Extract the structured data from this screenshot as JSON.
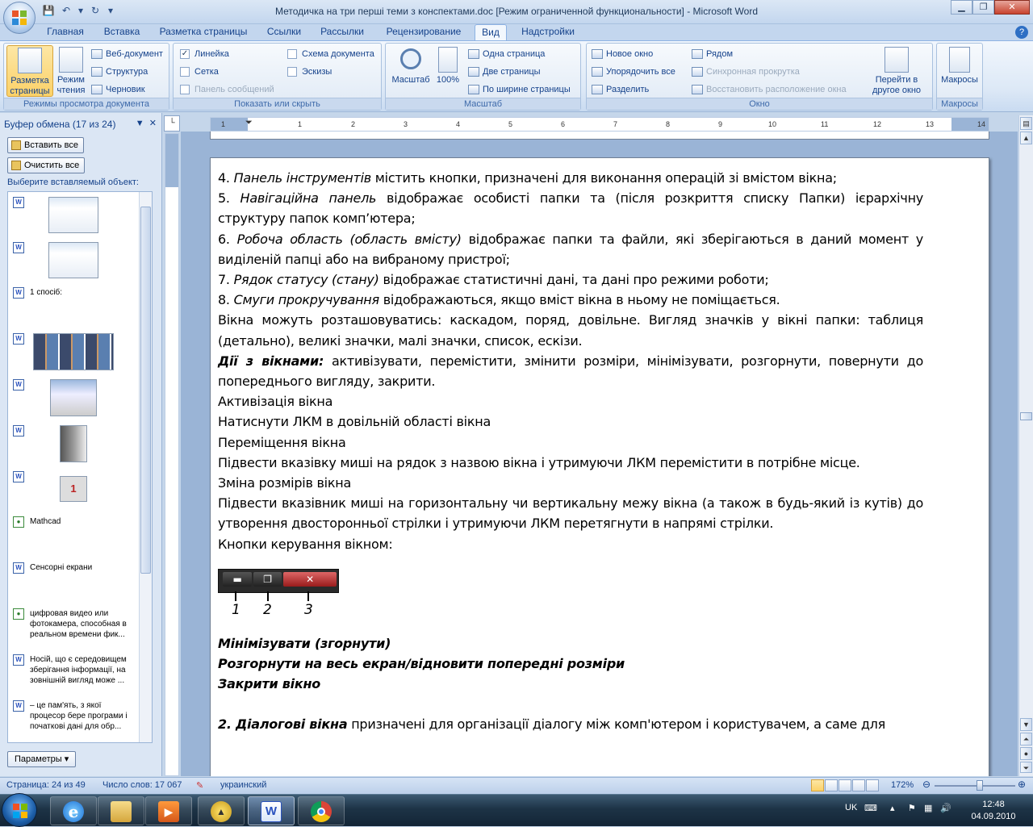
{
  "window": {
    "title": "Методичка на три перші теми з конспектами.doc [Режим ограниченной функциональности] - Microsoft Word"
  },
  "tabs": [
    "Главная",
    "Вставка",
    "Разметка страницы",
    "Ссылки",
    "Рассылки",
    "Рецензирование",
    "Вид",
    "Надстройки"
  ],
  "ribbon": {
    "views": {
      "print_layout": "Разметка страницы",
      "reading": "Режим чтения",
      "web": "Веб-документ",
      "outline": "Структура",
      "draft": "Черновик",
      "label": "Режимы просмотра документа"
    },
    "show": {
      "ruler": "Линейка",
      "grid": "Сетка",
      "message_bar": "Панель сообщений",
      "doc_map": "Схема документа",
      "thumbnails": "Эскизы",
      "label": "Показать или скрыть"
    },
    "zoom": {
      "zoom": "Масштаб",
      "hundred": "100%",
      "one_page": "Одна страница",
      "two_pages": "Две страницы",
      "page_width": "По ширине страницы",
      "label": "Масштаб"
    },
    "window": {
      "new_window": "Новое окно",
      "arrange_all": "Упорядочить все",
      "split": "Разделить",
      "side_by_side": "Рядом",
      "sync_scroll": "Синхронная прокрутка",
      "reset_position": "Восстановить расположение окна",
      "switch": "Перейти в другое окно",
      "label": "Окно"
    },
    "macros": {
      "macros": "Макросы",
      "label": "Макросы"
    }
  },
  "clipboard": {
    "header": "Буфер обмена (17 из 24)",
    "paste_all": "Вставить все",
    "clear_all": "Очистить все",
    "choose": "Выберите вставляемый объект:",
    "items": {
      "i3": "1 спосіб:",
      "i8": "Mathcad",
      "i9": "Сенсорні екрани",
      "i10": "цифровая видео или фотокамера, способная в реальном времени фик...",
      "i11": "Носій, що є середовищем зберігання інформації, на зовнішній вигляд може ...",
      "i12": "– це пам'ять, з якої процесор бере програми і початкові дані для обр..."
    },
    "params": "Параметры"
  },
  "ruler_numbers": [
    "1",
    "1",
    "2",
    "3",
    "4",
    "5",
    "6",
    "7",
    "8",
    "9",
    "10",
    "11",
    "12",
    "13",
    "14"
  ],
  "document": {
    "l1_num": "4. ",
    "l1_it": "Панель інструментів",
    "l1_rest": " містить кнопки, призначені для виконання операцій зі вмістом вікна;",
    "l2_num": "5. ",
    "l2_it": "Навігаційна панель",
    "l2_rest": " відображає особисті папки та (після розкриття списку Папки) ієрархічну структуру папок комп’ютера;",
    "l3_num": "6. ",
    "l3_it": "Робоча область (область вмісту)",
    "l3_rest": " відображає папки та файли, які зберігаються в даний момент у виділеній папці або на вибраному пристрої;",
    "l4_num": "7. ",
    "l4_it": "Рядок статусу (стану)",
    "l4_rest": " відображає статистичні дані, та дані про режими роботи;",
    "l5_num": "8. ",
    "l5_it": "Смуги прокручування",
    "l5_rest": " відображаються, якщо вміст вікна в ньому не поміщається.",
    "p1": "Вікна можуть розташовуватись: каскадом, поряд, довільне. Вигляд значків у вікні папки: таблиця (детально), великі значки, малі значки, список, ескізи.",
    "p2_bi": "Дії з вікнами:",
    "p2_rest": " активізувати, перемістити, змінити розміри, мінімізувати, розгорнути, повернути до попереднього вигляду, закрити.",
    "p3": "Активізація вікна",
    "p4": "Натиснути ЛКМ в довільній області вікна",
    "p5": "Переміщення вікна",
    "p6": "Підвести вказівку миші на рядок з назвою вікна і утримуючи ЛКМ перемістити в потрібне місце.",
    "p7": "Зміна розмірів вікна",
    "p8": "Підвести вказівник миші на горизонтальну чи вертикальну межу вікна (а також в будь-який із кутів) до утворення двосторонньої стрілки і утримуючи ЛКМ перетягнути в напрямі стрілки.",
    "p9": "Кнопки керування вікном:",
    "n1": "1",
    "n2": "2",
    "n3": "3",
    "q1": "Мінімізувати (згорнути)",
    "q2": "Розгорнути на весь екран/відновити попередні розміри",
    "q3": "Закрити вікно",
    "last_bi": "2. Діалогові вікна",
    "last_rest": " призначені для організації діалогу між комп'ютером і користувачем, а саме для"
  },
  "status": {
    "page": "Страница: 24 из 49",
    "words": "Число слов: 17 067",
    "lang": "украинский",
    "zoom": "172%"
  },
  "taskbar": {
    "lang": "UK",
    "time": "12:48",
    "date": "04.09.2010"
  }
}
